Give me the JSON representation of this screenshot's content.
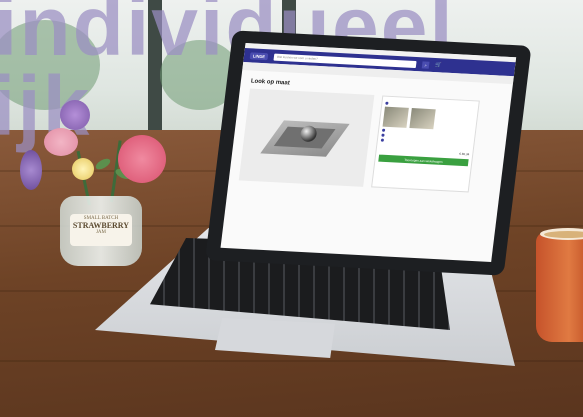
{
  "background_text": {
    "line1": "individueel",
    "line2": "ijk"
  },
  "website": {
    "logo": "LINDE",
    "search_placeholder": "Wat kunnen we voor u vinden?",
    "page_title": "Look op maat",
    "price": "€ 80,34",
    "add_to_cart": "Toevoegen aan winkelwagen"
  },
  "vase_label": {
    "top": "SMALL BATCH",
    "main": "STRAWBERRY",
    "sub": "JAM"
  },
  "colors": {
    "header": "#2e3190",
    "cart_button": "#3aa040",
    "heading_overlay": "#9b8fc3",
    "table": "#6e4326",
    "mug": "#d2642f"
  }
}
